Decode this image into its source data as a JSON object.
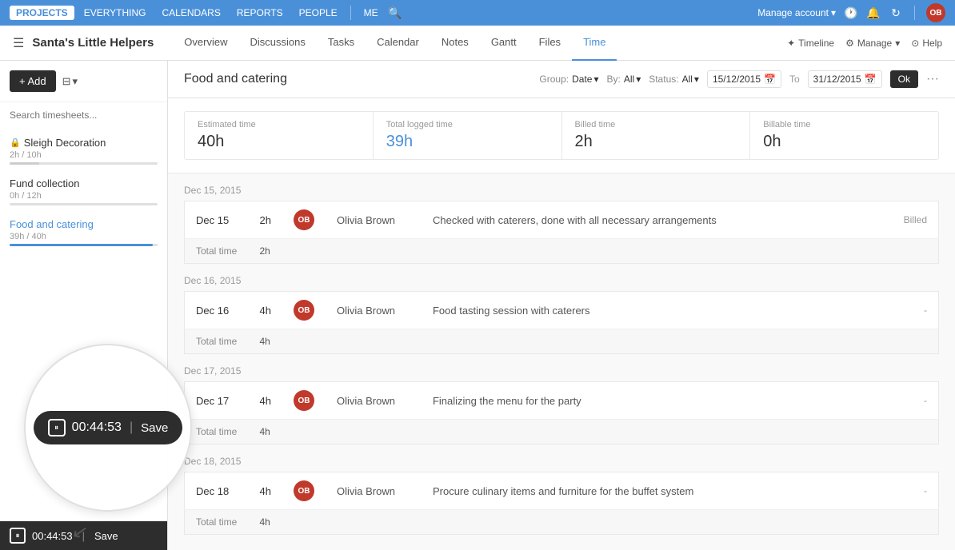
{
  "topNav": {
    "items": [
      {
        "id": "projects",
        "label": "PROJECTS",
        "active": true
      },
      {
        "id": "everything",
        "label": "EVERYTHING"
      },
      {
        "id": "calendars",
        "label": "CALENDARS"
      },
      {
        "id": "reports",
        "label": "REPORTS"
      },
      {
        "id": "people",
        "label": "PEOPLE"
      },
      {
        "id": "me",
        "label": "ME"
      }
    ],
    "manage_account": "Manage account",
    "search_icon": "🔍"
  },
  "secondNav": {
    "project_title": "Santa's Little Helpers",
    "tabs": [
      {
        "id": "overview",
        "label": "Overview"
      },
      {
        "id": "discussions",
        "label": "Discussions"
      },
      {
        "id": "tasks",
        "label": "Tasks"
      },
      {
        "id": "calendar",
        "label": "Calendar"
      },
      {
        "id": "notes",
        "label": "Notes"
      },
      {
        "id": "gantt",
        "label": "Gantt"
      },
      {
        "id": "files",
        "label": "Files"
      },
      {
        "id": "time",
        "label": "Time",
        "active": true
      }
    ],
    "timeline_btn": "Timeline",
    "manage_btn": "Manage",
    "help_btn": "Help"
  },
  "sidebar": {
    "add_label": "+ Add",
    "search_placeholder": "Search timesheets...",
    "items": [
      {
        "id": "sleigh",
        "name": "Sleigh Decoration",
        "locked": true,
        "meta": "2h / 10h",
        "progress": 20
      },
      {
        "id": "fund",
        "name": "Fund collection",
        "locked": false,
        "meta": "0h / 12h",
        "progress": 0
      },
      {
        "id": "food",
        "name": "Food and catering",
        "locked": false,
        "meta": "39h / 40h",
        "progress": 97,
        "active": true
      }
    ],
    "timer": {
      "time": "00:44:53",
      "save_label": "Save"
    }
  },
  "content": {
    "title": "Food and catering",
    "filters": {
      "group_label": "Group:",
      "group_value": "Date",
      "by_label": "By:",
      "by_value": "All",
      "status_label": "Status:",
      "status_value": "All",
      "date_from": "15/12/2015",
      "date_to": "31/12/2015",
      "ok_label": "Ok"
    },
    "stats": [
      {
        "label": "Estimated time",
        "value": "40h",
        "highlight": false
      },
      {
        "label": "Total logged time",
        "value": "39h",
        "highlight": true
      },
      {
        "label": "Billed time",
        "value": "2h",
        "highlight": false
      },
      {
        "label": "Billable time",
        "value": "0h",
        "highlight": false
      }
    ],
    "date_groups": [
      {
        "date": "Dec 15, 2015",
        "entries": [
          {
            "date": "Dec 15",
            "hours": "2h",
            "person": "Olivia Brown",
            "description": "Checked with caterers, done with all necessary arrangements",
            "status": "Billed"
          }
        ],
        "total": "2h"
      },
      {
        "date": "Dec 16, 2015",
        "entries": [
          {
            "date": "Dec 16",
            "hours": "4h",
            "person": "Olivia Brown",
            "description": "Food tasting session with caterers",
            "status": "-"
          }
        ],
        "total": "4h"
      },
      {
        "date": "Dec 17, 2015",
        "entries": [
          {
            "date": "Dec 17",
            "hours": "4h",
            "person": "Olivia Brown",
            "description": "Finalizing the menu for the party",
            "status": "-"
          }
        ],
        "total": "4h"
      },
      {
        "date": "Dec 18, 2015",
        "entries": [
          {
            "date": "Dec 18",
            "hours": "4h",
            "person": "Olivia Brown",
            "description": "Procure culinary items and furniture for the buffet system",
            "status": "-"
          }
        ],
        "total": "4h"
      }
    ]
  },
  "floatingTimer": {
    "time": "00:44:53",
    "save_label": "Save"
  }
}
